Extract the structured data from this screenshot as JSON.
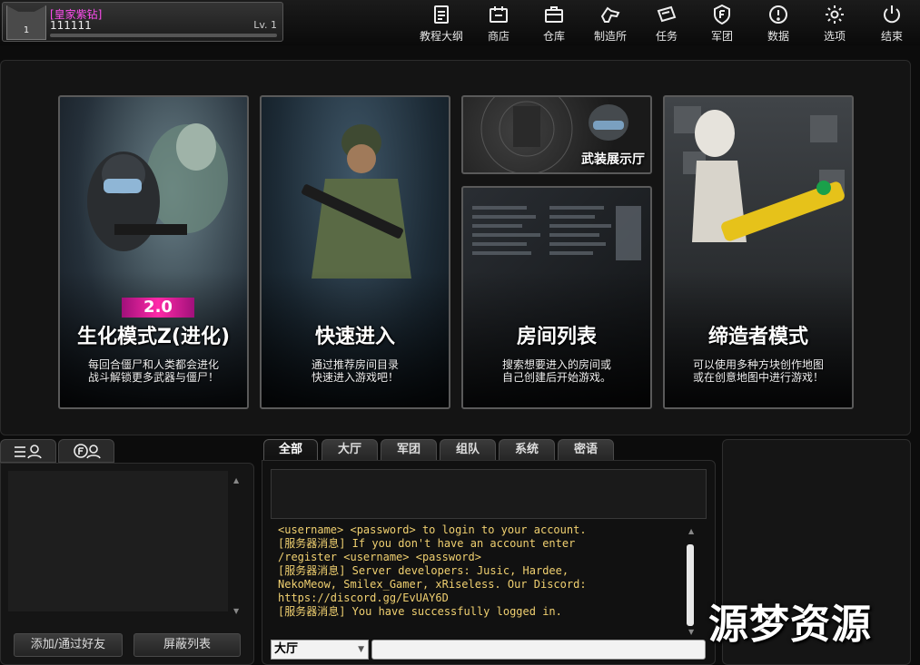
{
  "profile": {
    "vip": "[皇家紫钻]",
    "username": "111111",
    "level": "Lv. 1",
    "avatar_rank": "1",
    "xp_fraction": 0.0
  },
  "nav": [
    {
      "label": "教程大纲",
      "icon": "clipboard-icon"
    },
    {
      "label": "商店",
      "icon": "shop-icon"
    },
    {
      "label": "仓库",
      "icon": "briefcase-icon"
    },
    {
      "label": "制造所",
      "icon": "workshop-icon"
    },
    {
      "label": "任务",
      "icon": "mission-icon"
    },
    {
      "label": "军团",
      "icon": "clan-icon"
    },
    {
      "label": "数据",
      "icon": "alert-icon"
    },
    {
      "label": "选项",
      "icon": "gear-icon"
    },
    {
      "label": "结束",
      "icon": "power-icon"
    }
  ],
  "modes": {
    "zombie": {
      "badge": "2.0",
      "title": "生化模式Z(进化)",
      "desc1": "每回合僵尸和人类都会进化",
      "desc2": "战斗解锁更多武器与僵尸！"
    },
    "quick": {
      "title": "快速进入",
      "desc1": "通过推荐房间目录",
      "desc2": "快速进入游戏吧！"
    },
    "armory": {
      "title": "武装展示厅"
    },
    "rooms": {
      "title": "房间列表",
      "desc1": "搜索想要进入的房间或",
      "desc2": "自己创建后开始游戏。"
    },
    "creator": {
      "title": "缔造者模式",
      "desc1": "可以使用多种方块创作地图",
      "desc2": "或在创意地图中进行游戏！"
    }
  },
  "friends": {
    "add_button": "添加/通过好友",
    "block_button": "屏蔽列表"
  },
  "chat": {
    "tabs": [
      "全部",
      "大厅",
      "军团",
      "组队",
      "系统",
      "密语"
    ],
    "log": [
      "<username> <password> to login to your account.",
      "[服务器消息] If you don't have an account enter",
      "/register <username> <password>",
      "[服务器消息] Server developers: Jusic, Hardee,",
      "NekoMeow, Smilex_Gamer, xRiseless. Our Discord:",
      "https://discord.gg/EvUAY6D",
      "[服务器消息] You have successfully logged in."
    ],
    "channel": "大厅",
    "input_value": ""
  },
  "watermark": "源梦资源",
  "colors": {
    "vip": "#ff4df0",
    "log_text": "#f0d070",
    "badge": "#ff2aa8"
  }
}
